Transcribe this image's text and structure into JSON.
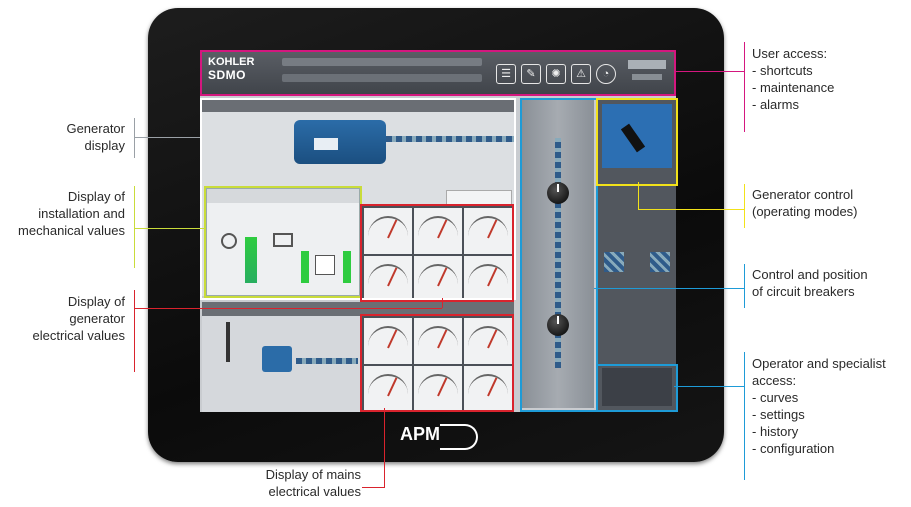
{
  "callouts": {
    "generator_display": [
      "Generator",
      "display"
    ],
    "installation_mechanical": [
      "Display of",
      "installation and",
      "mechanical values"
    ],
    "generator_electrical": [
      "Display of",
      "generator",
      "electrical values"
    ],
    "mains_electrical": [
      "Display of mains",
      "electrical values"
    ],
    "user_access": [
      "User access:",
      "- shortcuts",
      "- maintenance",
      "- alarms"
    ],
    "generator_control": [
      "Generator control",
      "(operating modes)"
    ],
    "circuit_breakers": [
      "Control and position",
      "of circuit breakers"
    ],
    "operator_access": [
      "Operator and specialist",
      "access:",
      "- curves",
      "- settings",
      "- history",
      "- configuration"
    ]
  },
  "device": {
    "brand_top": "KOHLER",
    "brand_bottom": "SDMO",
    "logo": "APM"
  },
  "colors": {
    "user_access": "#d4177f",
    "generator_display": "#ffffff",
    "mechanical": "#c9dc3a",
    "electrical": "#d9232d",
    "breakers": "#1e9bd7",
    "control": "#f2e21a",
    "operator": "#1e9bd7"
  },
  "icons": [
    "list-icon",
    "wrench-icon",
    "fan-icon",
    "alarm-icon",
    "gauge-icon"
  ]
}
